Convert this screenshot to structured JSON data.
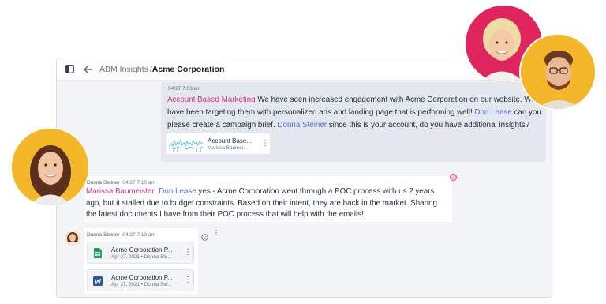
{
  "header": {
    "breadcrumb_parent": "ABM Insights",
    "breadcrumb_sep": "/",
    "breadcrumb_current": "Acme Corporation"
  },
  "message1": {
    "timestamp": "04/27 7:03 am",
    "mention1": "Account Based Marketing",
    "text1": " We have seen increased engagement with Acme Corporation on our website. We have been targeting them with personalized ads and landing page that is performing well! ",
    "mention2": "Don Lease",
    "text2": " can you please create a campaign brief. ",
    "mention3": "Donna Steiner",
    "text3": " since this is your account, do you have additional insights?",
    "attachment": {
      "title": "Account Base...",
      "subtitle": "Marissa Baumei..."
    }
  },
  "message2": {
    "author": "Donna Steiner",
    "timestamp": "04/27 7:10 am",
    "mention1": "Marissa Baumeister",
    "mention2": "Don Lease",
    "text": "  yes - Acme Corporation went through a POC process with us 2 years ago, but it stalled due to budget constraints. Based on their intent, they are back in the market. Sharing the latest documents I have from their POC process that will help with the emails!"
  },
  "message3": {
    "author": "Donna Steiner",
    "timestamp": "04/27 7:13 am",
    "files": [
      {
        "title": "Acme Corporation P...",
        "subtitle": "Apr 27, 2021 • Donna Ste...",
        "icon": "google-sheets-icon"
      },
      {
        "title": "Acme Corporation P...",
        "subtitle": "Apr 27, 2021 • Donna Ste...",
        "icon": "word-doc-icon"
      }
    ]
  },
  "colors": {
    "mention_pink": "#d63384",
    "mention_blue": "#4f6edb",
    "avatar_bg_left": "#f5b72a",
    "avatar_bg_top": "#e0245e",
    "avatar_bg_right": "#f5b72a"
  }
}
